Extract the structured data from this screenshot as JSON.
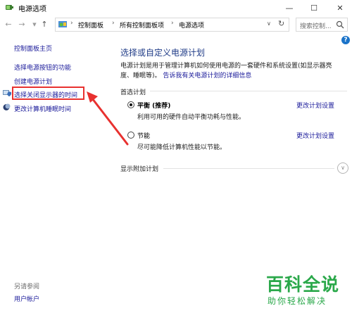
{
  "window": {
    "title": "电源选项",
    "minimize": "—",
    "maximize": "☐",
    "close": "✕"
  },
  "address_bar": {
    "breadcrumbs": [
      "控制面板",
      "所有控制面板项",
      "电源选项"
    ],
    "search_placeholder": "搜索控制..."
  },
  "left_pane": {
    "home": "控制面板主页",
    "items": [
      "选择电源按钮的功能",
      "创建电源计划",
      "选择关闭显示器的时间",
      "更改计算机睡眠时间"
    ],
    "see_also_label": "另请参阅",
    "user_accounts": "用户帐户"
  },
  "main": {
    "title": "选择或自定义电源计划",
    "desc_line1": "电源计划是用于管理计算机如何使用电源的一套硬件和系统设置(如显示器亮",
    "desc_line2": "度、睡眠等)。",
    "desc_link": "告诉我有关电源计划的详细信息",
    "section_label": "首选计划",
    "plans": [
      {
        "name": "平衡 (推荐)",
        "desc": "利用可用的硬件自动平衡功耗与性能。",
        "selected": true,
        "change_link": "更改计划设置"
      },
      {
        "name": "节能",
        "desc": "尽可能降低计算机性能以节能。",
        "selected": false,
        "change_link": "更改计划设置"
      }
    ],
    "more_plans_label": "显示附加计划"
  },
  "help_icon_text": "?",
  "watermark": {
    "title": "百科全说",
    "subtitle": "助你轻松解决"
  },
  "colors": {
    "link": "#1a1a9a",
    "title_blue": "#1f3b87",
    "highlight_red": "#e8312f",
    "watermark_green": "#2aa84a"
  }
}
